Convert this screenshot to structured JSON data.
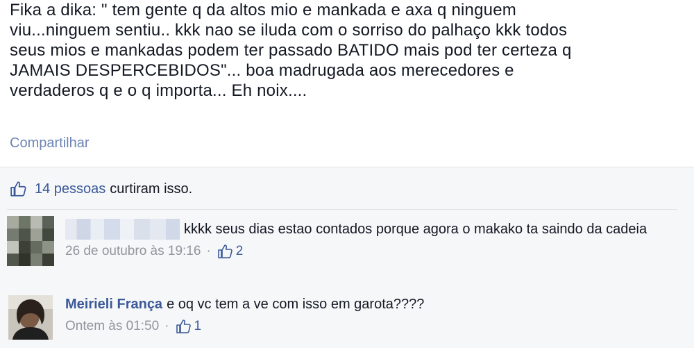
{
  "post": {
    "text": "Fika a dika: \" tem gente q da altos mio e mankada e axa q ninguem\nviu...ninguem sentiu.. kkk nao se iluda com o sorriso do palhaço kkk todos\nseus mios e mankadas podem ter passado BATIDO mais pod ter certeza q\nJAMAIS DESPERCEBIDOS\"... boa madrugada aos merecedores e\nverdaderos q e o q importa... Eh noix....",
    "share_label": "Compartilhar"
  },
  "likes": {
    "count_label": "14 pessoas",
    "suffix": "curtiram isso.",
    "icon": "thumbs-up-icon"
  },
  "comments": [
    {
      "author": "",
      "text": "kkkk seus dias estao contados porque agora o makako ta saindo da cadeia",
      "time": "26 de outubro às 19:16",
      "separator": "·",
      "likes": "2"
    },
    {
      "author": "Meirieli França",
      "text": "e oq vc tem a ve com isso em garota????",
      "time": "Ontem às 01:50",
      "separator": "·",
      "likes": "1"
    }
  ],
  "colors": {
    "link": "#3b5998",
    "muted": "#90949c",
    "share": "#6d84b4",
    "feedback_bg": "#f6f7f9"
  }
}
